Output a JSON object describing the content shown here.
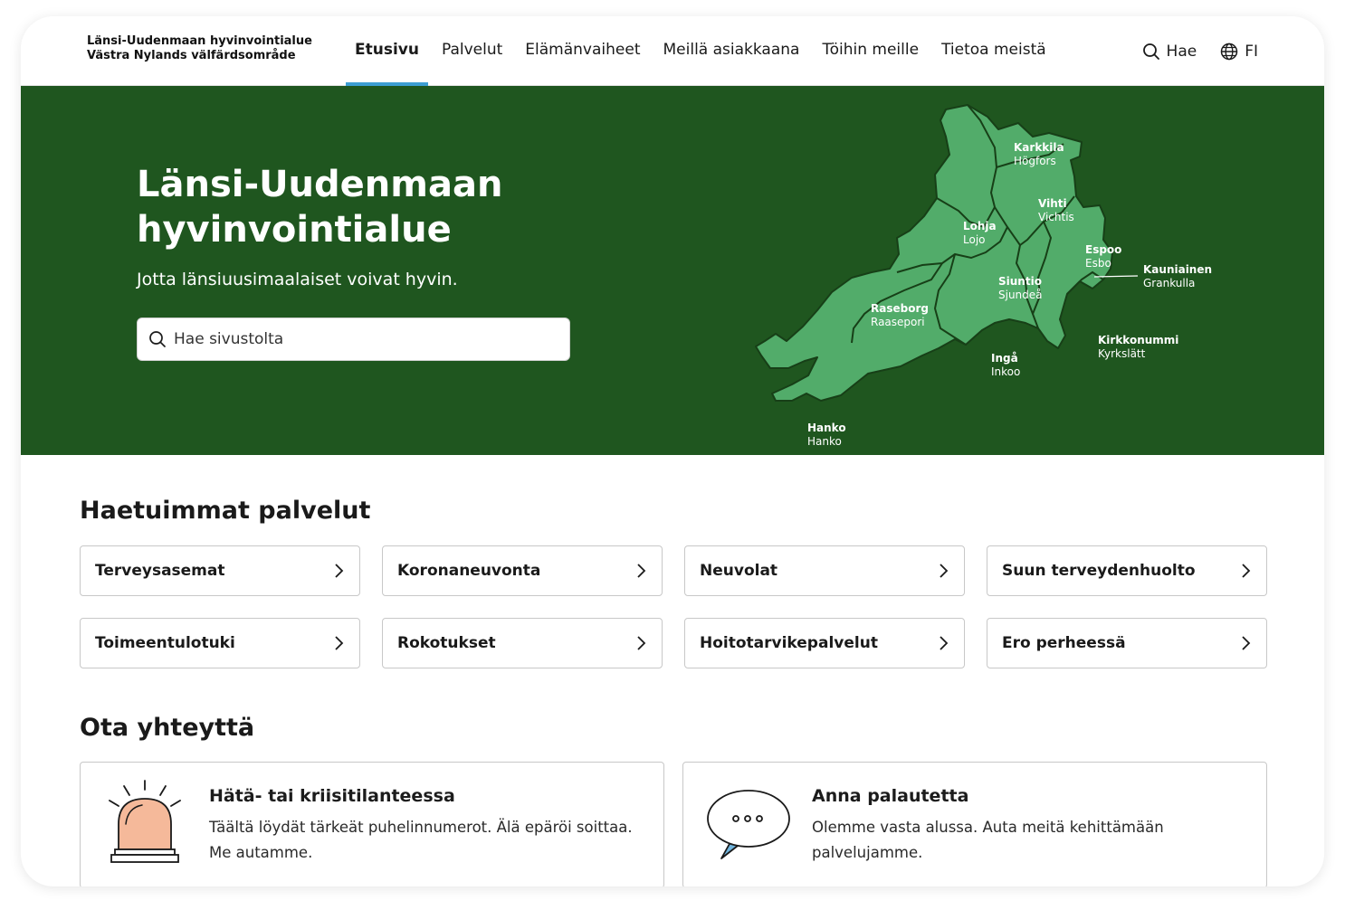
{
  "header": {
    "logo_fi": "Länsi-Uudenmaan hyvinvointialue",
    "logo_sv": "Västra Nylands välfärdsområde",
    "nav": [
      {
        "label": "Etusivu",
        "active": true
      },
      {
        "label": "Palvelut"
      },
      {
        "label": "Elämänvaiheet"
      },
      {
        "label": "Meillä asiakkaana"
      },
      {
        "label": "Töihin meille"
      },
      {
        "label": "Tietoa meistä"
      }
    ],
    "search_label": "Hae",
    "language_label": "FI",
    "search_icon": "search-icon",
    "language_icon": "globe-icon"
  },
  "hero": {
    "title_line1": "Länsi-Uudenmaan",
    "title_line2": "hyvinvointialue",
    "subtitle": "Jotta länsiuusimaalaiset voivat hyvin.",
    "search_placeholder": "Hae sivustolta",
    "background": "#1f561f",
    "map_color": "#52ac6a",
    "map_labels": [
      {
        "fi": "Karkkila",
        "sv": "Högfors"
      },
      {
        "fi": "Vihti",
        "sv": "Vichtis"
      },
      {
        "fi": "Lohja",
        "sv": "Lojo"
      },
      {
        "fi": "Espoo",
        "sv": "Esbo"
      },
      {
        "fi": "Kauniainen",
        "sv": "Grankulla"
      },
      {
        "fi": "Siuntio",
        "sv": "Sjundeå"
      },
      {
        "fi": "Raseborg",
        "sv": "Raasepori"
      },
      {
        "fi": "Kirkkonummi",
        "sv": "Kyrkslätt"
      },
      {
        "fi": "Ingå",
        "sv": "Inkoo"
      },
      {
        "fi": "Hanko",
        "sv": "Hanko"
      }
    ]
  },
  "services": {
    "title": "Haetuimmat palvelut",
    "items": [
      "Terveysasemat",
      "Koronaneuvonta",
      "Neuvolat",
      "Suun terveydenhuolto",
      "Toimeentulotuki",
      "Rokotukset",
      "Hoitotarvikepalvelut",
      "Ero perheessä"
    ]
  },
  "contact": {
    "title": "Ota yhteyttä",
    "cards": [
      {
        "title": "Hätä- tai kriisitilanteessa",
        "text": "Täältä löydät tärkeät puhelinnumerot. Älä epäröi soittaa. Me autamme.",
        "icon": "emergency-light-icon"
      },
      {
        "title": "Anna palautetta",
        "text": "Olemme vasta alussa. Auta meitä kehittämään palvelujamme.",
        "icon": "speech-bubble-icon"
      }
    ]
  }
}
